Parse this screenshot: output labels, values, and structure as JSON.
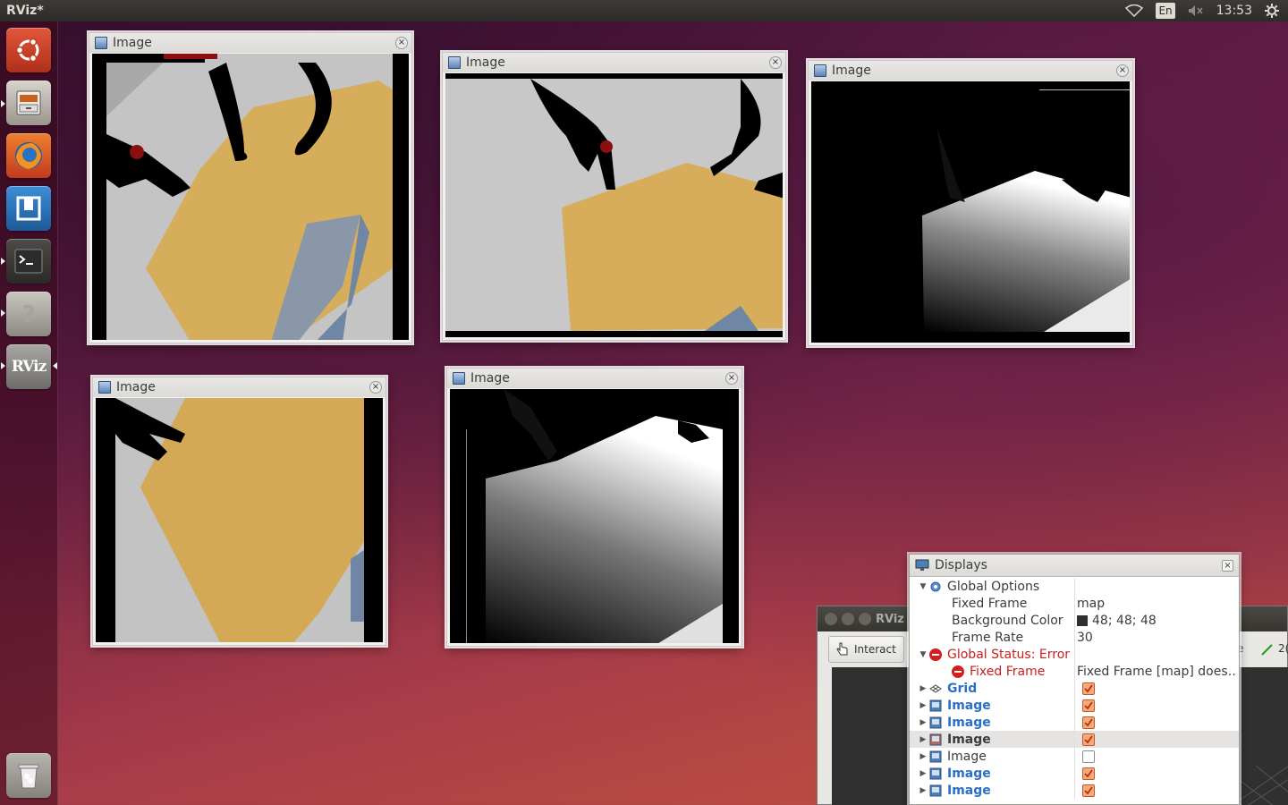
{
  "topbar": {
    "title": "RViz*",
    "lang": "En",
    "time": "13:53"
  },
  "image_windows": [
    {
      "title": "Image",
      "close": "×"
    },
    {
      "title": "Image",
      "close": "×"
    },
    {
      "title": "Image",
      "close": "×"
    },
    {
      "title": "Image",
      "close": "×"
    },
    {
      "title": "Image",
      "close": "×"
    }
  ],
  "launcher": {
    "items": [
      "ubuntu-logo",
      "files",
      "firefox",
      "app-grid",
      "terminal",
      "help",
      "rviz",
      "trash"
    ],
    "rviz_label": "RViz"
  },
  "rviz_window": {
    "title": "RViz",
    "interact_label": "Interact",
    "right_text": "e",
    "right_num": "2("
  },
  "displays": {
    "title": "Displays",
    "close": "×",
    "global_options": "Global Options",
    "fixed_frame_label": "Fixed Frame",
    "fixed_frame_value": "map",
    "bg_color_label": "Background Color",
    "bg_color_value": "48; 48; 48",
    "bg_color_hex": "#303030",
    "frame_rate_label": "Frame Rate",
    "frame_rate_value": "30",
    "status_label": "Global Status: Error",
    "status_fixed_frame": "Fixed Frame",
    "status_fixed_frame_msg": "Fixed Frame [map] does…",
    "grid_label": "Grid",
    "image_rows": [
      {
        "label": "Image",
        "checked": true,
        "style": "blue"
      },
      {
        "label": "Image",
        "checked": true,
        "style": "blue"
      },
      {
        "label": "Image",
        "checked": true,
        "style": "bold",
        "selected": true
      },
      {
        "label": "Image",
        "checked": false,
        "style": "plain"
      },
      {
        "label": "Image",
        "checked": true,
        "style": "blue"
      },
      {
        "label": "Image",
        "checked": true,
        "style": "blue"
      }
    ]
  }
}
